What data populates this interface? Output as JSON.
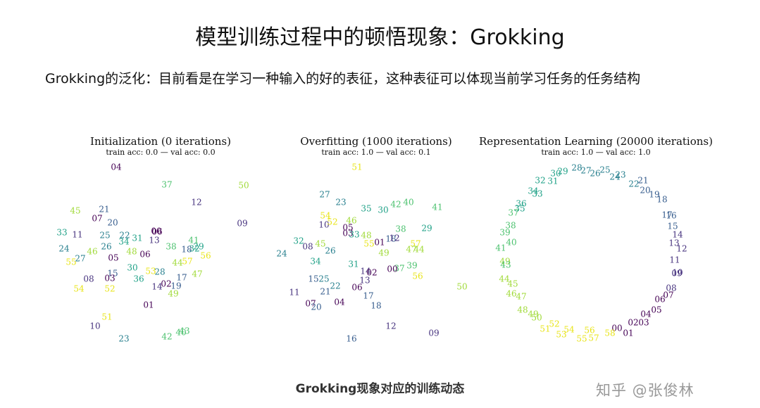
{
  "page": {
    "title": "模型训练过程中的顿悟现象：Grokking",
    "subtitle": "Grokking的泛化：目前看是在学习一种输入的好的表征，这种表征可以体现当前学习任务的任务结构",
    "caption": "Grokking现象对应的训练动态",
    "watermark": "知乎 @张俊林"
  },
  "panels": [
    {
      "title": "Initialization (0 iterations)",
      "subtitle": "train acc: 0.0 — val acc: 0.0",
      "points": [
        [
          "04",
          165,
          238
        ],
        [
          "37",
          237,
          263
        ],
        [
          "50",
          346,
          264
        ],
        [
          "12",
          279,
          288
        ],
        [
          "45",
          107,
          300
        ],
        [
          "21",
          148,
          298
        ],
        [
          "07",
          138,
          311
        ],
        [
          "20",
          160,
          317
        ],
        [
          "09",
          344,
          318
        ],
        [
          "33",
          88,
          331
        ],
        [
          "11",
          110,
          334
        ],
        [
          "25",
          149,
          335
        ],
        [
          "22",
          177,
          335
        ],
        [
          "31",
          195,
          339
        ],
        [
          "34",
          176,
          344
        ],
        [
          "13",
          219,
          342
        ],
        [
          "00",
          222,
          329
        ],
        [
          "06",
          223,
          330
        ],
        [
          "41",
          275,
          342
        ],
        [
          "24",
          91,
          354
        ],
        [
          "26",
          151,
          351
        ],
        [
          "48",
          187,
          358
        ],
        [
          "06",
          206,
          362
        ],
        [
          "38",
          243,
          351
        ],
        [
          "18",
          265,
          355
        ],
        [
          "32",
          276,
          354
        ],
        [
          "29",
          282,
          351
        ],
        [
          "56",
          292,
          364
        ],
        [
          "27",
          114,
          368
        ],
        [
          "46",
          131,
          358
        ],
        [
          "05",
          161,
          367
        ],
        [
          "44",
          252,
          374
        ],
        [
          "57",
          266,
          372
        ],
        [
          "55",
          101,
          373
        ],
        [
          "30",
          188,
          381
        ],
        [
          "53",
          214,
          386
        ],
        [
          "28",
          227,
          387
        ],
        [
          "08",
          126,
          397
        ],
        [
          "15",
          160,
          389
        ],
        [
          "03",
          156,
          396
        ],
        [
          "36",
          197,
          397
        ],
        [
          "17",
          258,
          395
        ],
        [
          "47",
          280,
          390
        ],
        [
          "54",
          112,
          411
        ],
        [
          "52",
          156,
          411
        ],
        [
          "14",
          223,
          408
        ],
        [
          "02",
          236,
          404
        ],
        [
          "19",
          250,
          407
        ],
        [
          "49",
          246,
          418
        ],
        [
          "01",
          211,
          434
        ],
        [
          "51",
          152,
          451
        ],
        [
          "10",
          135,
          464
        ],
        [
          "43",
          262,
          471
        ],
        [
          "40",
          257,
          473
        ],
        [
          "42",
          237,
          479
        ],
        [
          "23",
          176,
          482
        ]
      ]
    },
    {
      "title": "Overfitting (1000 iterations)",
      "subtitle": "train acc: 1.0 — val acc: 0.1",
      "points": [
        [
          "51",
          507,
          238
        ],
        [
          "27",
          461,
          277
        ],
        [
          "23",
          484,
          288
        ],
        [
          "35",
          520,
          297
        ],
        [
          "30",
          544,
          299
        ],
        [
          "42",
          562,
          291
        ],
        [
          "40",
          580,
          288
        ],
        [
          "41",
          621,
          295
        ],
        [
          "54",
          462,
          307
        ],
        [
          "10",
          460,
          320
        ],
        [
          "52",
          472,
          316
        ],
        [
          "46",
          499,
          314
        ],
        [
          "05",
          494,
          324
        ],
        [
          "03",
          494,
          332
        ],
        [
          "33",
          503,
          334
        ],
        [
          "38",
          569,
          326
        ],
        [
          "29",
          606,
          325
        ],
        [
          "48",
          520,
          335
        ],
        [
          "01",
          539,
          345
        ],
        [
          "18",
          555,
          340
        ],
        [
          "12",
          560,
          339
        ],
        [
          "32",
          424,
          343
        ],
        [
          "08",
          437,
          351
        ],
        [
          "45",
          455,
          347
        ],
        [
          "55",
          524,
          347
        ],
        [
          "57",
          590,
          347
        ],
        [
          "47",
          584,
          355
        ],
        [
          "44",
          595,
          355
        ],
        [
          "24",
          400,
          361
        ],
        [
          "26",
          469,
          357
        ],
        [
          "49",
          545,
          360
        ],
        [
          "34",
          448,
          372
        ],
        [
          "31",
          502,
          376
        ],
        [
          "39",
          585,
          378
        ],
        [
          "37",
          567,
          382
        ],
        [
          "00",
          557,
          383
        ],
        [
          "56",
          593,
          393
        ],
        [
          "14",
          519,
          386
        ],
        [
          "02",
          528,
          388
        ],
        [
          "13",
          518,
          399
        ],
        [
          "15",
          445,
          397
        ],
        [
          "25",
          460,
          397
        ],
        [
          "22",
          476,
          407
        ],
        [
          "06",
          507,
          409
        ],
        [
          "21",
          462,
          415
        ],
        [
          "11",
          418,
          416
        ],
        [
          "50",
          656,
          408
        ],
        [
          "17",
          523,
          421
        ],
        [
          "07",
          441,
          432
        ],
        [
          "20",
          449,
          437
        ],
        [
          "04",
          482,
          430
        ],
        [
          "18",
          534,
          435
        ],
        [
          "12",
          555,
          464
        ],
        [
          "09",
          616,
          474
        ],
        [
          "16",
          499,
          482
        ]
      ]
    },
    {
      "title": "Representation Learning (20000 iterations)",
      "subtitle": "train acc: 1.0 — val acc: 1.0",
      "points": [
        [
          "28",
          819,
          239
        ],
        [
          "27",
          832,
          243
        ],
        [
          "26",
          845,
          247
        ],
        [
          "25",
          859,
          242
        ],
        [
          "30",
          789,
          247
        ],
        [
          "29",
          799,
          244
        ],
        [
          "24",
          873,
          252
        ],
        [
          "23",
          881,
          249
        ],
        [
          "32",
          767,
          257
        ],
        [
          "31",
          785,
          258
        ],
        [
          "22",
          900,
          262
        ],
        [
          "21",
          913,
          257
        ],
        [
          "34",
          757,
          272
        ],
        [
          "33",
          763,
          276
        ],
        [
          "20",
          916,
          271
        ],
        [
          "19",
          929,
          277
        ],
        [
          "18",
          940,
          284
        ],
        [
          "36",
          740,
          290
        ],
        [
          "35",
          738,
          297
        ],
        [
          "37",
          729,
          303
        ],
        [
          "17",
          947,
          306
        ],
        [
          "16",
          953,
          307
        ],
        [
          "38",
          725,
          321
        ],
        [
          "15",
          955,
          322
        ],
        [
          "39",
          717,
          331
        ],
        [
          "14",
          962,
          334
        ],
        [
          "40",
          726,
          345
        ],
        [
          "13",
          957,
          346
        ],
        [
          "12",
          968,
          354
        ],
        [
          "41",
          711,
          353
        ],
        [
          "11",
          958,
          370
        ],
        [
          "49",
          717,
          372
        ],
        [
          "43",
          718,
          377
        ],
        [
          "10",
          962,
          388
        ],
        [
          "09",
          961,
          389
        ],
        [
          "44",
          716,
          397
        ],
        [
          "45",
          728,
          404
        ],
        [
          "08",
          953,
          410
        ],
        [
          "07",
          949,
          420
        ],
        [
          "06",
          937,
          426
        ],
        [
          "46",
          726,
          418
        ],
        [
          "47",
          740,
          422
        ],
        [
          "05",
          932,
          441
        ],
        [
          "04",
          917,
          447
        ],
        [
          "48",
          742,
          441
        ],
        [
          "49",
          757,
          447
        ],
        [
          "50",
          762,
          452
        ],
        [
          "03",
          914,
          459
        ],
        [
          "02",
          899,
          459
        ],
        [
          "52",
          787,
          461
        ],
        [
          "51",
          774,
          468
        ],
        [
          "54",
          808,
          469
        ],
        [
          "56",
          837,
          470
        ],
        [
          "01",
          892,
          474
        ],
        [
          "00",
          876,
          467
        ],
        [
          "53",
          797,
          476
        ],
        [
          "58",
          866,
          474
        ],
        [
          "55",
          826,
          482
        ],
        [
          "57",
          843,
          481
        ]
      ]
    }
  ],
  "colors": {
    "palette": [
      "#440154",
      "#46327e",
      "#365c8d",
      "#277f8e",
      "#1fa187",
      "#4ac16d",
      "#a0da39",
      "#e8e419"
    ]
  }
}
